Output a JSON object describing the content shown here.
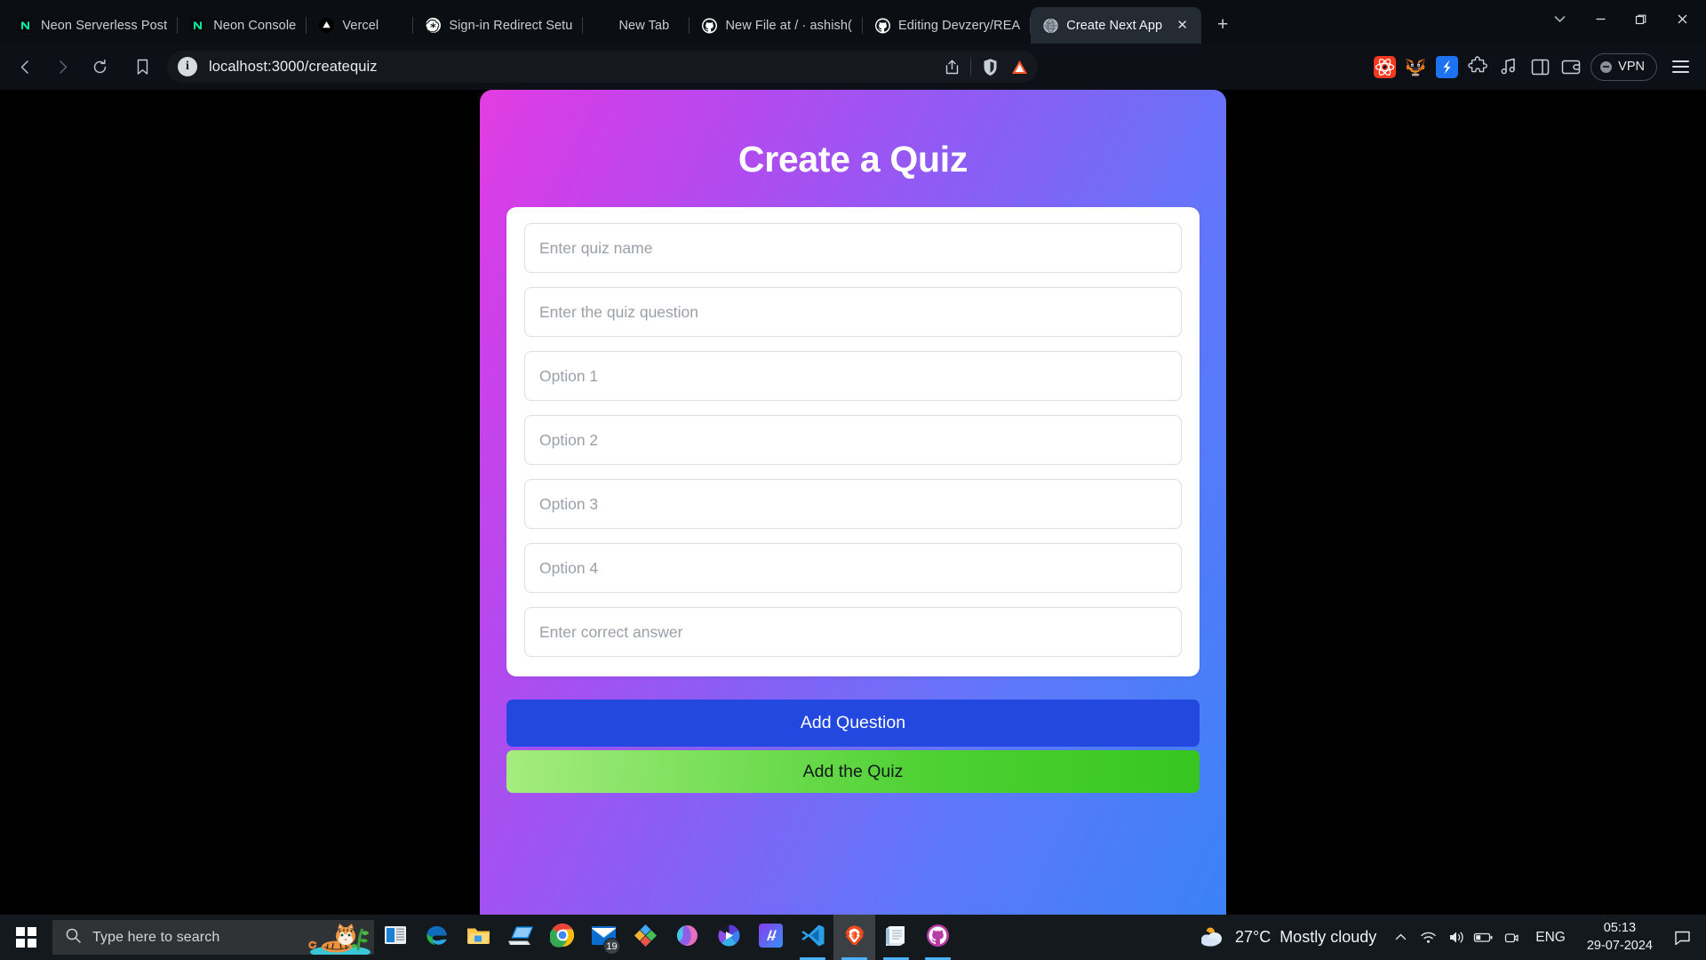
{
  "browser": {
    "tabs": [
      {
        "title": "Neon Serverless Post",
        "icon": "neon-icon",
        "active": false
      },
      {
        "title": "Neon Console",
        "icon": "neon-icon",
        "active": false
      },
      {
        "title": "Vercel",
        "icon": "vercel-icon",
        "active": false
      },
      {
        "title": "Sign-in Redirect Setu",
        "icon": "openai-icon",
        "active": false
      },
      {
        "title": "New Tab",
        "icon": "none",
        "active": false
      },
      {
        "title": "New File at / · ashish(",
        "icon": "github-icon",
        "active": false
      },
      {
        "title": "Editing Devzery/REA",
        "icon": "github-icon",
        "active": false
      },
      {
        "title": "Create Next App",
        "icon": "globe-icon",
        "active": true
      }
    ],
    "new_tab_label": "+",
    "tab_close_label": "✕",
    "window_controls": {
      "tab_search": "tab-search",
      "minimize": "minimize",
      "maximize": "maximize",
      "close": "close"
    },
    "nav": {
      "back": "back",
      "forward": "forward",
      "reload": "reload",
      "bookmark": "bookmark"
    },
    "url": "localhost:3000/createquiz",
    "url_info_label": "i",
    "url_icons": [
      "share-icon",
      "brave-shields-icon",
      "brave-rewards-icon"
    ],
    "extensions": [
      "react-devtools-icon",
      "metamask-icon",
      "stake-icon",
      "puzzle-extensions-icon",
      "music-icon",
      "sidebar-icon",
      "wallet-icon"
    ],
    "vpn_label": "VPN",
    "menu_label": "browser-menu"
  },
  "page": {
    "title": "Create a Quiz",
    "fields": [
      {
        "name": "quiz-name-input",
        "placeholder": "Enter quiz name",
        "value": ""
      },
      {
        "name": "quiz-question-input",
        "placeholder": "Enter the quiz question",
        "value": ""
      },
      {
        "name": "option-1-input",
        "placeholder": "Option 1",
        "value": ""
      },
      {
        "name": "option-2-input",
        "placeholder": "Option 2",
        "value": ""
      },
      {
        "name": "option-3-input",
        "placeholder": "Option 3",
        "value": ""
      },
      {
        "name": "option-4-input",
        "placeholder": "Option 4",
        "value": ""
      },
      {
        "name": "correct-answer-input",
        "placeholder": "Enter correct answer",
        "value": ""
      }
    ],
    "add_question_label": "Add Question",
    "add_quiz_label": "Add the Quiz",
    "colors": {
      "gradient_start": "#e23ee2",
      "gradient_end": "#3b82f6",
      "primary_button": "#2348e0",
      "success_button_start": "#a5ec7e",
      "success_button_end": "#36c61f"
    }
  },
  "taskbar": {
    "start_label": "start",
    "search_placeholder": "Type here to search",
    "apps": [
      {
        "name": "task-view",
        "label": "Task View"
      },
      {
        "name": "microsoft-edge",
        "label": "Microsoft Edge"
      },
      {
        "name": "file-explorer",
        "label": "File Explorer"
      },
      {
        "name": "remote-desktop",
        "label": "Remote Desktop"
      },
      {
        "name": "google-chrome",
        "label": "Google Chrome"
      },
      {
        "name": "mail",
        "label": "Mail",
        "badge": "19"
      },
      {
        "name": "microsoft-store",
        "label": "Microsoft Store"
      },
      {
        "name": "microsoft-office",
        "label": "Microsoft 365"
      },
      {
        "name": "movies-tv",
        "label": "Movies & TV"
      },
      {
        "name": "ai-app",
        "label": "AI App"
      },
      {
        "name": "visual-studio-code",
        "label": "Visual Studio Code"
      },
      {
        "name": "brave-browser",
        "label": "Brave"
      },
      {
        "name": "notepad",
        "label": "Notepad"
      },
      {
        "name": "github-desktop",
        "label": "GitHub Desktop"
      }
    ],
    "weather": {
      "temperature": "27°C",
      "description": "Mostly cloudy"
    },
    "tray_icons": [
      "show-hidden-icons",
      "network-icon",
      "volume-icon",
      "battery-icon",
      "camera-icon"
    ],
    "language": "ENG",
    "time": "05:13",
    "date": "29-07-2024",
    "action_center": "action-center"
  }
}
